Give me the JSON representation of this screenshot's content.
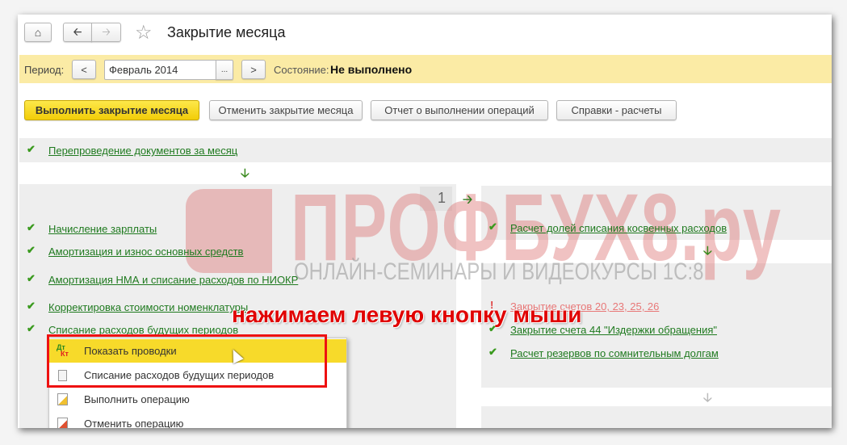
{
  "header": {
    "title": "Закрытие месяца",
    "home": "home-icon",
    "back": "arrow-left-icon",
    "forward": "arrow-right-icon",
    "favorite": "star-icon"
  },
  "period_bar": {
    "label": "Период:",
    "prev": "<",
    "value": "Февраль 2014",
    "picker": "...",
    "next": ">",
    "status_label": "Состояние:",
    "status_value": "Не выполнено"
  },
  "actions": {
    "run": "Выполнить закрытие месяца",
    "cancel": "Отменить закрытие месяца",
    "report": "Отчет о выполнении операций",
    "help": "Справки - расчеты"
  },
  "steps": {
    "repost": "Перепроведение документов за месяц",
    "stage_number": "1",
    "left": [
      "Начисление зарплаты",
      "Амортизация и износ основных средств",
      "Амортизация НМА и списание расходов по НИОКР",
      "Корректировка стоимости номенклатуры",
      "Списание расходов будущих периодов"
    ],
    "right": [
      "Расчет долей списания косвенных расходов",
      "Закрытие счетов 20, 23, 25, 26",
      "Закрытие счета 44 \"Издержки обращения\"",
      "Расчет резервов по сомнительным долгам"
    ]
  },
  "context_menu": [
    "Показать проводки",
    "Списание расходов будущих периодов",
    "Выполнить операцию",
    "Отменить операцию"
  ],
  "menu_icon_text": {
    "dt": "Дт",
    "kt": "Кт"
  },
  "annotation": "нажимаем левую кнопку мыши",
  "watermark": {
    "brand": "ПРОФБУХ8.ру",
    "tagline": "ОНЛАЙН-СЕМИНАРЫ И ВИДЕОКУРСЫ 1С:8"
  },
  "colors": {
    "accent_yellow": "#f7da2a",
    "link_green": "#1f7a1f",
    "error_red": "#e87878",
    "annotation_red": "#e00000"
  }
}
